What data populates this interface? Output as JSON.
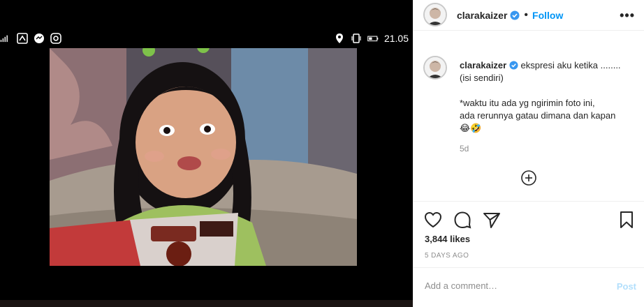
{
  "media": {
    "statusbar": {
      "time": "21.05",
      "left_icons": [
        "signal-icon",
        "nfc-icon",
        "messenger-icon",
        "instagram-icon"
      ],
      "right_icons": [
        "location-icon",
        "vibrate-icon",
        "battery-icon"
      ]
    },
    "photo_subject": "girl-with-magazine-photo"
  },
  "post": {
    "username": "clarakaizer",
    "follow_label": "Follow",
    "separator": "•",
    "more_label": "•••",
    "caption": {
      "text": "ekspresi aku ketika ........",
      "lines": [
        "(isi sendiri)",
        "",
        "*waktu itu ada yg ngirimin foto ini,",
        "ada rerunnya gatau dimana dan kapan",
        "😂🤣"
      ],
      "time": "5d"
    },
    "likes": "3,844 likes",
    "posted_ago": "5 DAYS AGO",
    "comment_placeholder": "Add a comment…",
    "post_label": "Post"
  },
  "colors": {
    "accent": "#0095f6",
    "muted": "#8e8e8e",
    "border": "#efefef",
    "post_disabled": "#b2dffc",
    "verified": "#3897f0"
  }
}
